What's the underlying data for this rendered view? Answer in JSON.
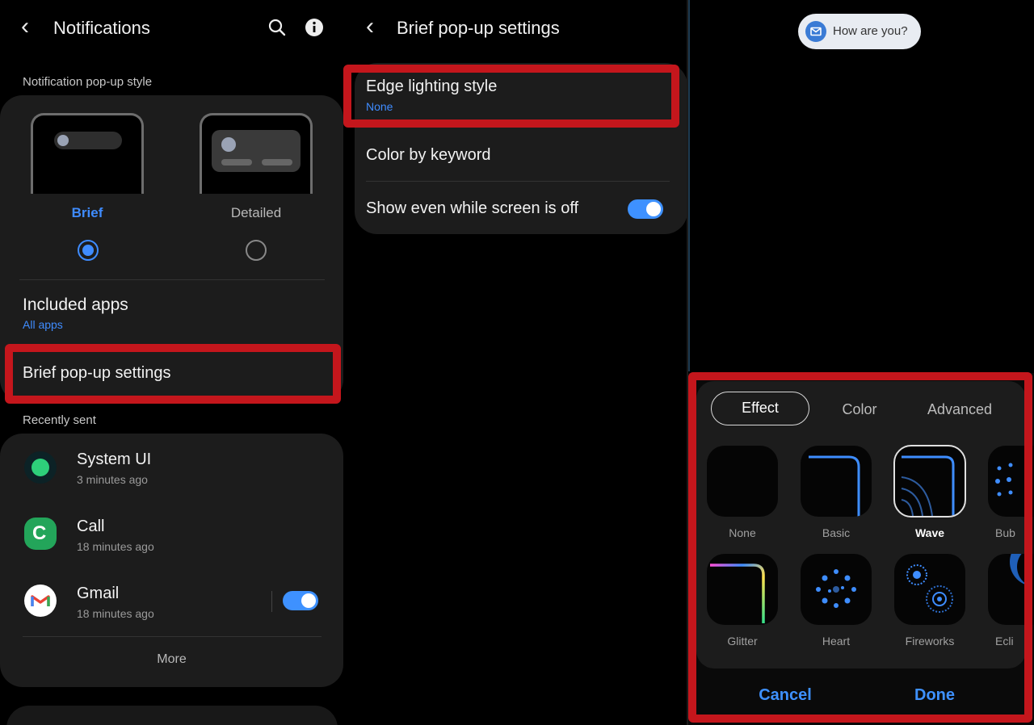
{
  "notifications_screen": {
    "title": "Notifications",
    "popup_style_label": "Notification pop-up style",
    "options": [
      {
        "label": "Brief",
        "selected": true
      },
      {
        "label": "Detailed",
        "selected": false
      }
    ],
    "included_apps": {
      "title": "Included apps",
      "value": "All apps"
    },
    "brief_popup_settings": "Brief pop-up settings",
    "recently_sent_label": "Recently sent",
    "recent_apps": [
      {
        "name": "System UI",
        "time": "3 minutes ago",
        "icon": "system-ui-icon"
      },
      {
        "name": "Call",
        "time": "18 minutes ago",
        "icon": "call-icon"
      },
      {
        "name": "Gmail",
        "time": "18 minutes ago",
        "icon": "gmail-icon",
        "toggle_on": true
      }
    ],
    "more_label": "More"
  },
  "brief_popup_screen": {
    "title": "Brief pop-up settings",
    "edge_lighting": {
      "title": "Edge lighting style",
      "value": "None"
    },
    "color_by_keyword": "Color by keyword",
    "show_screen_off": {
      "label": "Show even while screen is off",
      "on": true
    }
  },
  "edge_lighting_screen": {
    "notification_pill": "How are you?",
    "tabs": [
      {
        "label": "Effect",
        "active": true
      },
      {
        "label": "Color",
        "active": false
      },
      {
        "label": "Advanced",
        "active": false
      }
    ],
    "effects_row1": [
      "None",
      "Basic",
      "Wave",
      "Bub"
    ],
    "effects_row2": [
      "Glitter",
      "Heart",
      "Fireworks",
      "Ecli"
    ],
    "selected_effect": "Wave",
    "cancel_label": "Cancel",
    "done_label": "Done"
  },
  "colors": {
    "accent": "#3f8cff",
    "highlight_red": "#c4161c",
    "card_bg": "#1c1c1c"
  }
}
